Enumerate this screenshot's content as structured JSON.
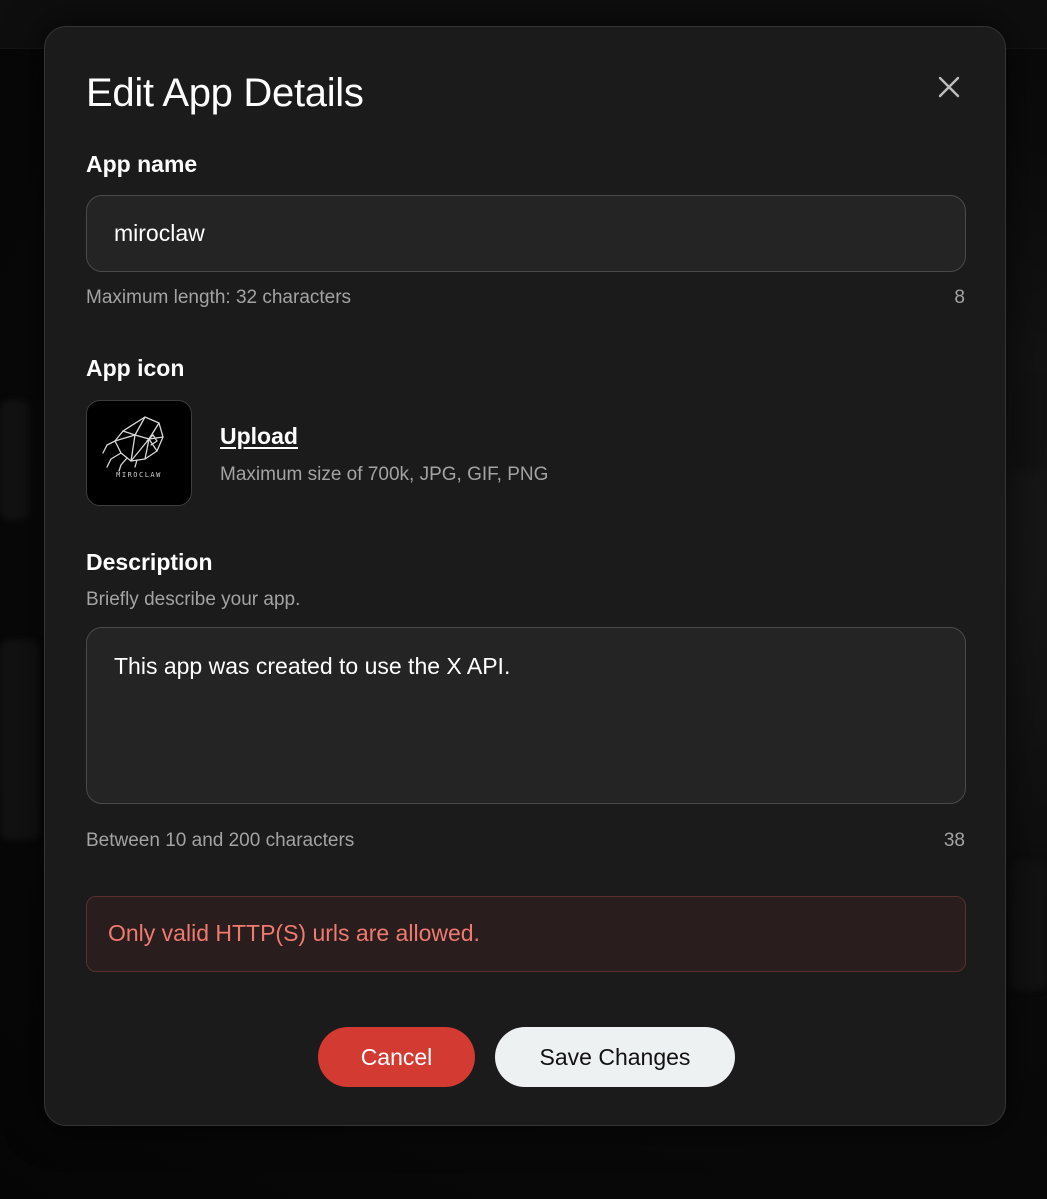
{
  "modal": {
    "title": "Edit App Details",
    "close_icon": "close-icon"
  },
  "app_name": {
    "label": "App name",
    "value": "miroclaw",
    "hint": "Maximum length: 32 characters",
    "count": "8"
  },
  "app_icon": {
    "label": "App icon",
    "image_caption": "MIROCLAW",
    "upload_label": "Upload",
    "hint": "Maximum size of 700k, JPG, GIF, PNG"
  },
  "description": {
    "label": "Description",
    "subtitle": "Briefly describe your app.",
    "value": "This app was created to use the X API.",
    "hint": "Between 10 and 200 characters",
    "count": "38"
  },
  "error": {
    "message": "Only valid HTTP(S) urls are allowed."
  },
  "actions": {
    "cancel_label": "Cancel",
    "save_label": "Save Changes"
  },
  "colors": {
    "modal_bg": "#1b1b1b",
    "cancel_bg": "#d23a32",
    "save_bg": "#eef1f1",
    "error_text": "#ef7a70",
    "error_bg": "#2a1d1d"
  }
}
